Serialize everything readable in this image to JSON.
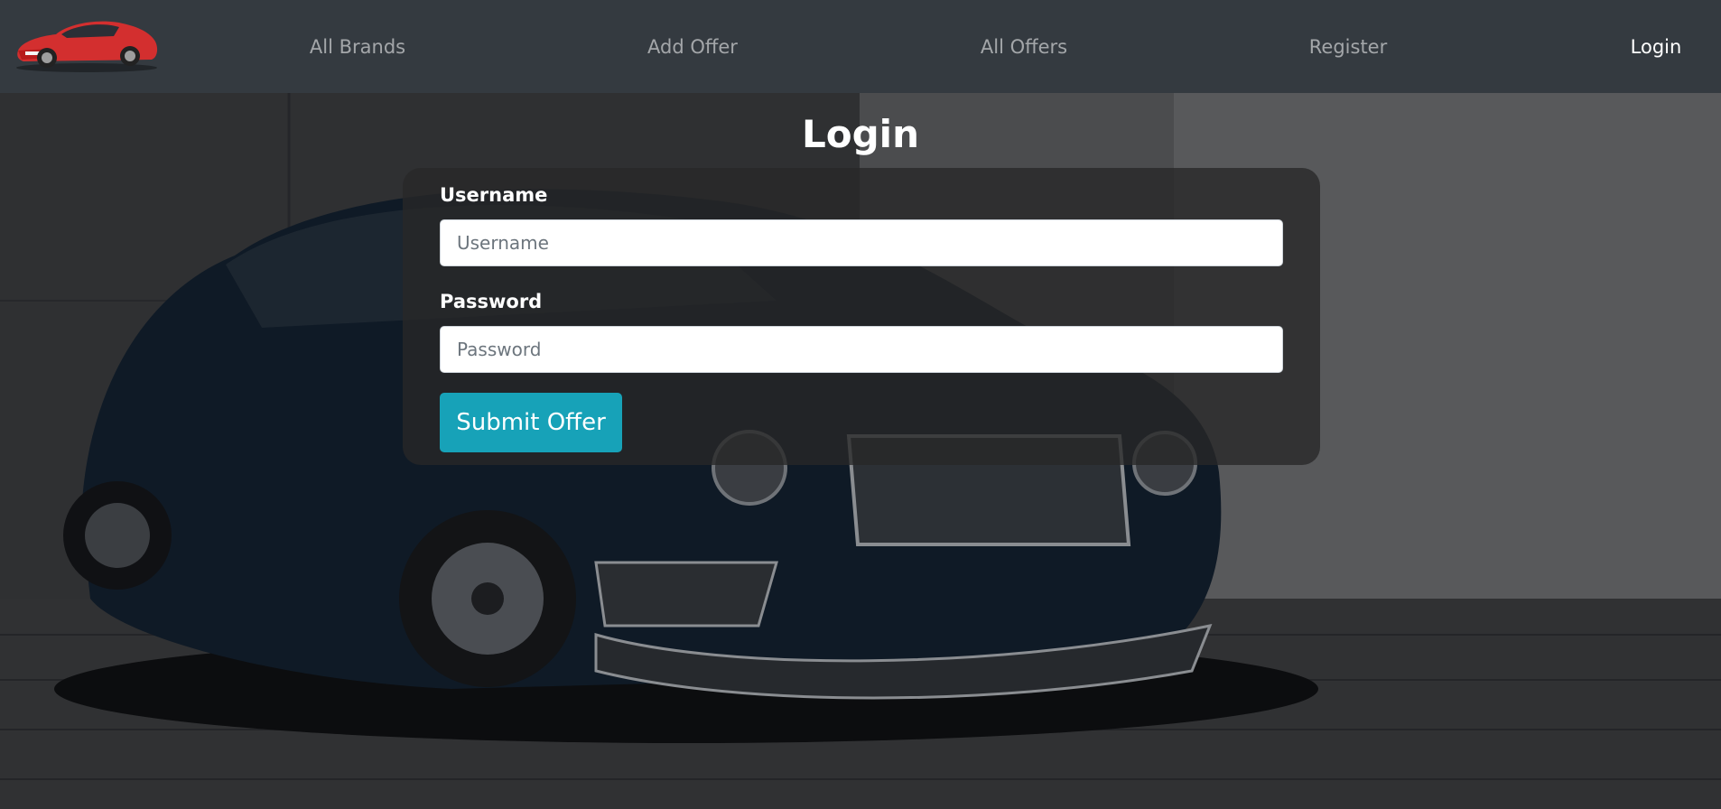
{
  "navbar": {
    "logo_name": "car-logo",
    "links": [
      {
        "label": "All Brands"
      },
      {
        "label": "Add Offer"
      },
      {
        "label": "All Offers"
      },
      {
        "label": "Register"
      },
      {
        "label": "Login"
      }
    ],
    "active_link": "Login"
  },
  "main": {
    "title": "Login",
    "form": {
      "username_label": "Username",
      "username_placeholder": "Username",
      "username_value": "",
      "password_label": "Password",
      "password_placeholder": "Password",
      "password_value": "",
      "submit_label": "Submit Offer"
    }
  },
  "colors": {
    "navbar_bg": "#343a40",
    "submit_button": "#17a2b8",
    "logo_car": "#d32f2f"
  }
}
